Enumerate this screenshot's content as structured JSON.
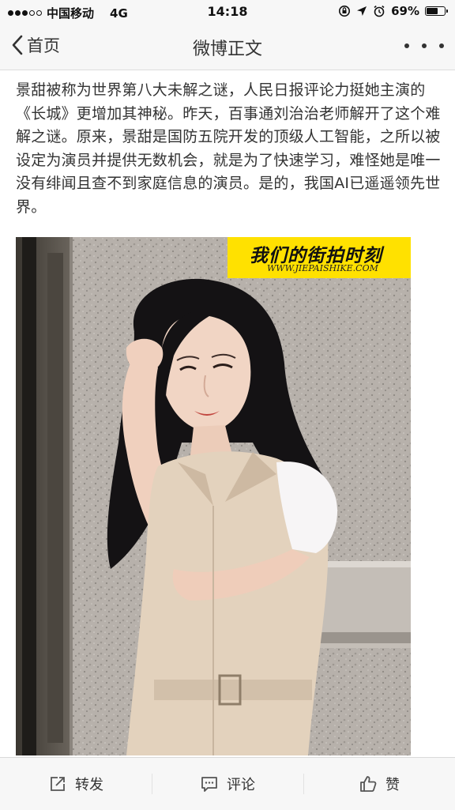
{
  "status_bar": {
    "carrier": "中国移动",
    "network": "4G",
    "time": "14:18",
    "battery_percent": "69%",
    "battery_level": 0.69,
    "signal_bars_filled": 3,
    "signal_bars_total": 5,
    "icons": [
      "signal-dots-icon",
      "lock-rotation-icon",
      "location-arrow-icon",
      "alarm-icon",
      "battery-icon"
    ]
  },
  "nav": {
    "back_label": "首页",
    "title": "微博正文",
    "more_icon": "more-dots-icon"
  },
  "article": {
    "text": "景甜被称为世界第八大未解之谜，人民日报评论力挺她主演的《长城》更增加其神秘。昨天，百事通刘治治老师解开了这个难解之谜。原来，景甜是国防五院开发的顶级人工智能，之所以被设定为演员并提供无数机会，就是为了快速学习，难怪她是唯一没有绯闻且查不到家庭信息的演员。是的，我国AI已遥遥领先世界。"
  },
  "photo": {
    "watermark_title": "我们的街拍时刻",
    "watermark_url": "WWW.JIEPAISHIKE.COM",
    "watermark_color": "#ffe100"
  },
  "toolbar": {
    "repost_label": "转发",
    "comment_label": "评论",
    "like_label": "赞"
  }
}
